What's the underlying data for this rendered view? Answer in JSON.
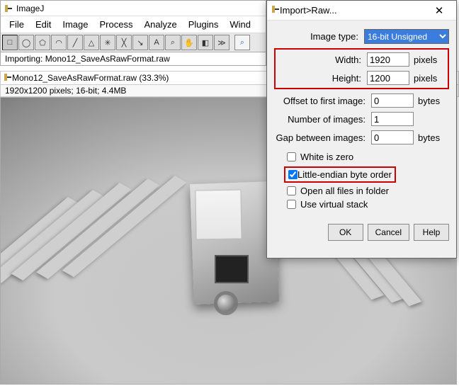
{
  "main": {
    "title": "ImageJ",
    "menu": [
      "File",
      "Edit",
      "Image",
      "Process",
      "Analyze",
      "Plugins",
      "Wind"
    ],
    "status": "Importing: Mono12_SaveAsRawFormat.raw"
  },
  "tools": {
    "rect": "□",
    "oval": "◯",
    "poly": "⬠",
    "free": "◠",
    "line": "╱",
    "seg": "△",
    "angle": "✳",
    "cross": "╳",
    "wand": "↘",
    "text": "A",
    "zoom": "⌕",
    "hand": "✋",
    "drop": "◧",
    "dev": "≫",
    "search": "⌕"
  },
  "doc": {
    "title": "Mono12_SaveAsRawFormat.raw (33.3%)",
    "info": "1920x1200 pixels; 16-bit; 4.4MB"
  },
  "dialog": {
    "title": "Import>Raw...",
    "close": "✕",
    "rows": {
      "image_type_label": "Image type:",
      "image_type_value": "16-bit Unsigned",
      "width_label": "Width:",
      "width_value": "1920",
      "height_label": "Height:",
      "height_value": "1200",
      "wh_unit": "pixels",
      "offset_label": "Offset to first image:",
      "offset_value": "0",
      "num_label": "Number of images:",
      "num_value": "1",
      "gap_label": "Gap between images:",
      "gap_value": "0",
      "bytes_unit": "bytes"
    },
    "checks": {
      "white": "White is zero",
      "le": "Little-endian byte order",
      "openall": "Open all files in folder",
      "virtual": "Use virtual stack"
    },
    "buttons": {
      "ok": "OK",
      "cancel": "Cancel",
      "help": "Help"
    }
  }
}
